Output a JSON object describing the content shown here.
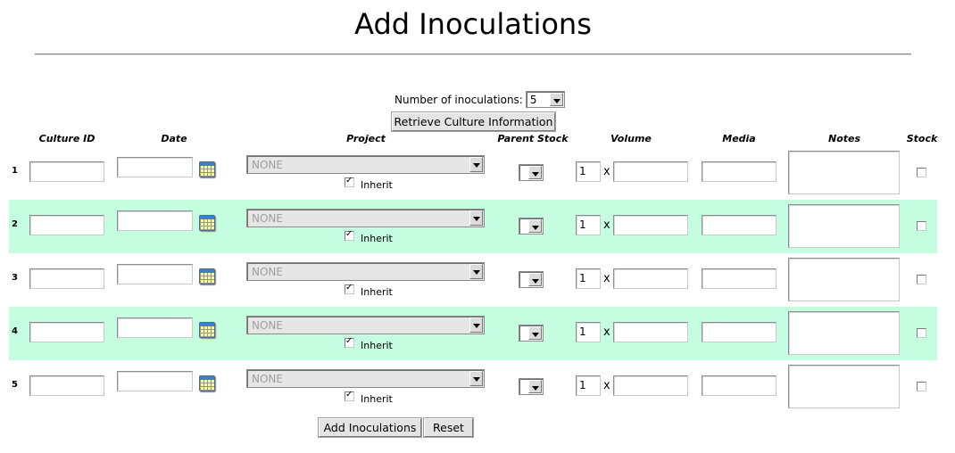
{
  "page": {
    "title": "Add Inoculations",
    "num_label": "Number of inoculations:",
    "num_value": "5",
    "retrieve_label": "Retrieve Culture Information",
    "submit_label": "Add Inoculations",
    "reset_label": "Reset"
  },
  "headers": {
    "culture_id": "Culture ID",
    "date": "Date",
    "project": "Project",
    "parent_stock": "Parent Stock",
    "volume": "Volume",
    "media": "Media",
    "notes": "Notes",
    "stock": "Stock"
  },
  "rows": [
    {
      "num": "1",
      "project": "NONE",
      "inherit_label": "Inherit",
      "inherit_checked": true,
      "volume_qty": "1",
      "x": "x",
      "stock_checked": false
    },
    {
      "num": "2",
      "project": "NONE",
      "inherit_label": "Inherit",
      "inherit_checked": true,
      "volume_qty": "1",
      "x": "x",
      "stock_checked": false
    },
    {
      "num": "3",
      "project": "NONE",
      "inherit_label": "Inherit",
      "inherit_checked": true,
      "volume_qty": "1",
      "x": "x",
      "stock_checked": false
    },
    {
      "num": "4",
      "project": "NONE",
      "inherit_label": "Inherit",
      "inherit_checked": true,
      "volume_qty": "1",
      "x": "x",
      "stock_checked": false
    },
    {
      "num": "5",
      "project": "NONE",
      "inherit_label": "Inherit",
      "inherit_checked": true,
      "volume_qty": "1",
      "x": "x",
      "stock_checked": false
    }
  ],
  "colors": {
    "alt_row": "#c4fde0"
  }
}
